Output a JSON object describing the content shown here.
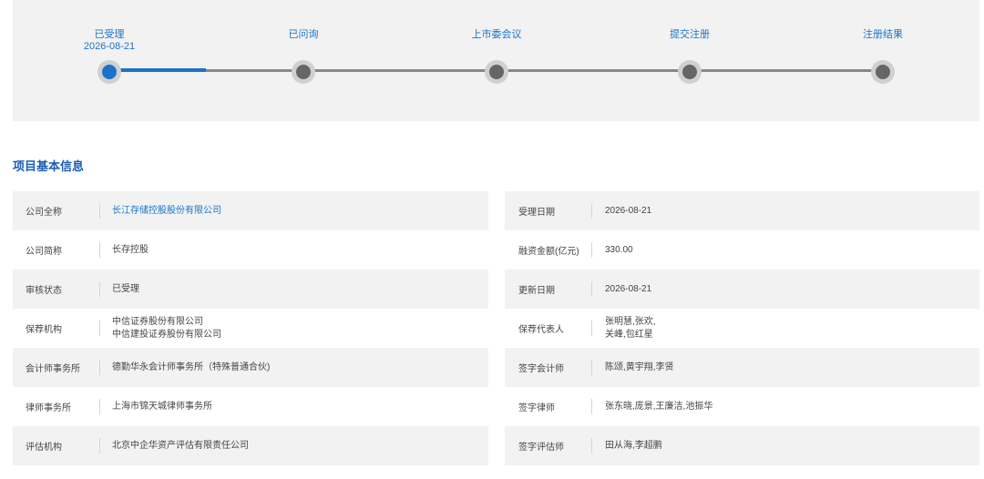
{
  "progress": {
    "steps": [
      {
        "label": "已受理",
        "date": "2026-08-21",
        "state": "done"
      },
      {
        "label": "已问询",
        "date": "",
        "state": "pending"
      },
      {
        "label": "上市委会议",
        "date": "",
        "state": "pending"
      },
      {
        "label": "提交注册",
        "date": "",
        "state": "pending"
      },
      {
        "label": "注册结果",
        "date": "",
        "state": "pending"
      }
    ],
    "accent_color": "#1a73c9"
  },
  "section_title": "项目基本信息",
  "left_rows": [
    {
      "label": "公司全称",
      "lines": [
        "长江存储控股股份有限公司"
      ],
      "link": true
    },
    {
      "label": "公司简称",
      "lines": [
        "长存控股"
      ]
    },
    {
      "label": "审核状态",
      "lines": [
        "已受理"
      ]
    },
    {
      "label": "保荐机构",
      "lines": [
        "中信证券股份有限公司",
        "中信建投证券股份有限公司"
      ]
    },
    {
      "label": "会计师事务所",
      "lines": [
        "德勤华永会计师事务所（特殊普通合伙)"
      ]
    },
    {
      "label": "律师事务所",
      "lines": [
        "上海市锦天城律师事务所"
      ]
    },
    {
      "label": "评估机构",
      "lines": [
        "北京中企华资产评估有限责任公司"
      ]
    }
  ],
  "right_rows": [
    {
      "label": "受理日期",
      "lines": [
        "2026-08-21"
      ]
    },
    {
      "label": "融资金额(亿元)",
      "lines": [
        "330.00"
      ]
    },
    {
      "label": "更新日期",
      "lines": [
        "2026-08-21"
      ]
    },
    {
      "label": "保荐代表人",
      "lines": [
        "张明慧,张欢,",
        "关峰,包红星"
      ]
    },
    {
      "label": "签字会计师",
      "lines": [
        "陈颂,黄宇翔,李贤"
      ]
    },
    {
      "label": "签字律师",
      "lines": [
        "张东晓,庞景,王廉洁,池振华"
      ]
    },
    {
      "label": "签字评估师",
      "lines": [
        "田从海,李超鹏"
      ]
    }
  ]
}
